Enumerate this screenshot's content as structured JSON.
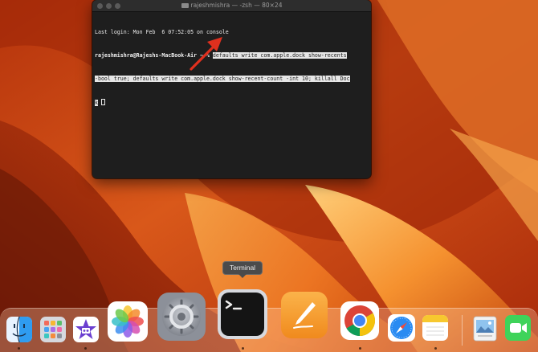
{
  "terminal": {
    "title": "rajeshmishra — -zsh — 80×24",
    "last_login": "Last login: Mon Feb  6 07:52:05 on console",
    "prompt": "rajeshmishra@Rajeshs-MacBook-Air ~ % ",
    "command_line1": "defaults write com.apple.dock show-recents",
    "command_line2": "-bool true; defaults write com.apple.dock show-recent-count -int 10; killall Doc",
    "command_line3": "k"
  },
  "tooltip": {
    "label": "Terminal"
  },
  "dock": {
    "items": [
      {
        "name": "Finder",
        "icon": "finder-icon",
        "running": true
      },
      {
        "name": "Launchpad",
        "icon": "launchpad-icon",
        "running": false
      },
      {
        "name": "iMovie",
        "icon": "imovie-icon",
        "running": true
      },
      {
        "name": "Photos",
        "icon": "photos-icon",
        "running": false
      },
      {
        "name": "System Settings",
        "icon": "settings-icon",
        "running": false
      },
      {
        "name": "Terminal",
        "icon": "terminal-icon",
        "running": true
      },
      {
        "name": "Pages",
        "icon": "pages-icon",
        "running": false
      },
      {
        "name": "Google Chrome",
        "icon": "chrome-icon",
        "running": true
      },
      {
        "name": "Safari",
        "icon": "safari-icon",
        "running": false
      },
      {
        "name": "Notes",
        "icon": "notes-icon",
        "running": true
      },
      {
        "name": "Preview",
        "icon": "preview-icon",
        "running": false
      },
      {
        "name": "FaceTime",
        "icon": "facetime-icon",
        "running": false
      }
    ]
  },
  "colors": {
    "annotation_arrow": "#e0301e",
    "terminal_bg": "#1e1e1e"
  }
}
